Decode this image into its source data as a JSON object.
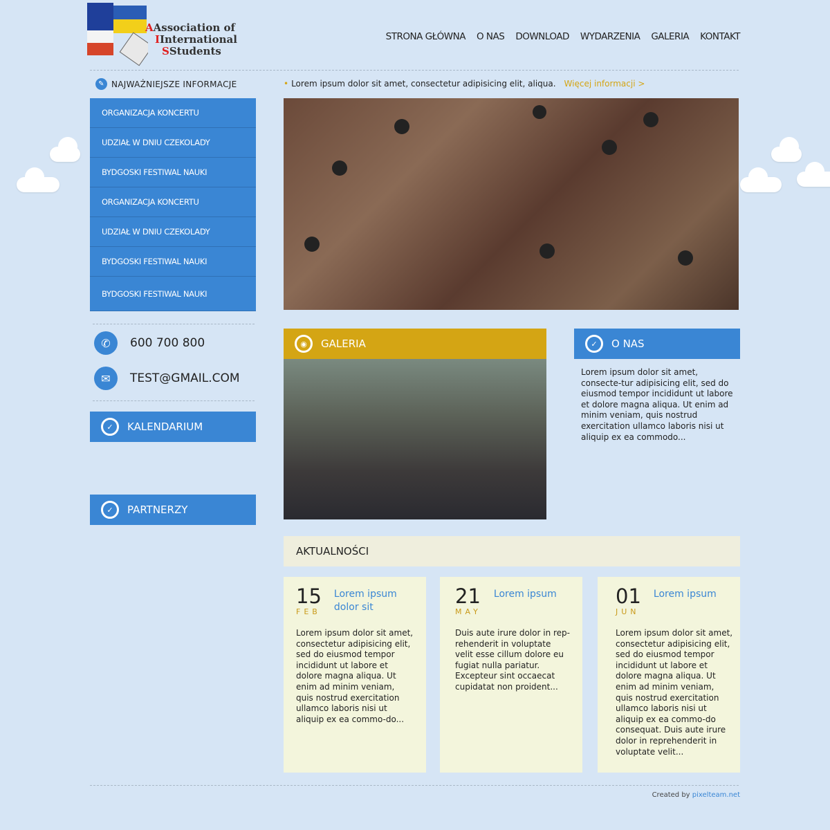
{
  "logo": {
    "line1": "Association of",
    "line2": "International",
    "line3": "Students"
  },
  "nav": [
    "STRONA GŁÓWNA",
    "O NAS",
    "DOWNLOAD",
    "WYDARZENIA",
    "GALERIA",
    "KONTAKT"
  ],
  "info": {
    "heading": "NAJWAŻNIEJSZE INFORMACJE",
    "ticker": "Lorem ipsum dolor sit amet, consectetur adipisicing elit, aliqua.",
    "more": "Więcej informacji >"
  },
  "menu": [
    "ORGANIZACJA KONCERTU",
    "UDZIAŁ W DNIU CZEKOLADY",
    "BYDGOSKI FESTIWAL NAUKI",
    "ORGANIZACJA KONCERTU",
    "UDZIAŁ W DNIU CZEKOLADY",
    "BYDGOSKI FESTIWAL NAUKI",
    "BYDGOSKI FESTIWAL NAUKI"
  ],
  "contact": {
    "phone": "600 700 800",
    "email": "TEST@GMAIL.COM"
  },
  "kalendarium": "KALENDARIUM",
  "partnerzy": "PARTNERZY",
  "galeria": "GALERIA",
  "onas": {
    "title": "O NAS",
    "text": "Lorem ipsum dolor sit amet, consecte-tur adipisicing elit, sed do eiusmod tempor incididunt ut labore et dolore magna aliqua. Ut enim ad minim veniam, quis nostrud exercitation ullamco laboris nisi ut aliquip ex ea commodo..."
  },
  "aktualnosci": "AKTUALNOŚCI",
  "news": [
    {
      "day": "15",
      "month": "FEB",
      "title": "Lorem ipsum dolor sit",
      "text": "Lorem ipsum dolor sit amet, consectetur adipisicing elit, sed do eiusmod tempor incididunt ut labore et dolore magna aliqua. Ut enim ad minim veniam, quis nostrud exercitation ullamco laboris nisi ut aliquip ex ea commo-do..."
    },
    {
      "day": "21",
      "month": "MAY",
      "title": "Lorem ipsum",
      "text": "Duis aute irure dolor in rep-rehenderit in voluptate velit esse cillum dolore eu fugiat nulla pariatur. Excepteur sint occaecat cupidatat non proident..."
    },
    {
      "day": "01",
      "month": "JUN",
      "title": "Lorem ipsum",
      "text": "Lorem ipsum dolor sit amet, consectetur adipisicing elit, sed do eiusmod tempor incididunt ut labore et dolore magna aliqua. Ut enim ad minim veniam, quis nostrud exercitation ullamco laboris nisi ut aliquip ex ea commo-do consequat. Duis aute irure dolor in reprehenderit in voluptate velit..."
    }
  ],
  "footer": {
    "prefix": "Created by",
    "link": "pixelteam.net"
  }
}
